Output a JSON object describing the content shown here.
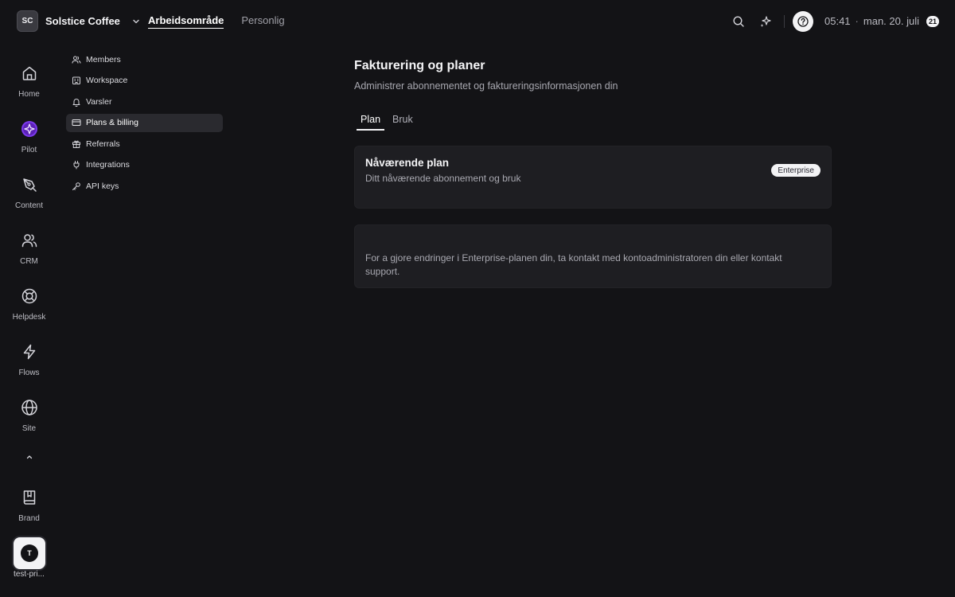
{
  "workspace": {
    "initials": "SC",
    "name": "Solstice Coffee"
  },
  "top_tabs": [
    {
      "label": "Arbeidsområde",
      "active": true
    },
    {
      "label": "Personlig",
      "active": false
    }
  ],
  "top_right": {
    "icons": [
      "search-icon",
      "sparkles-icon",
      "help-icon"
    ],
    "time": "05:41",
    "separator": "·",
    "date": "man. 20. juli",
    "day_badge": "21"
  },
  "rail": {
    "items": [
      {
        "label": "Home",
        "icon": "home-icon"
      },
      {
        "label": "Pilot",
        "icon": "pilot-icon"
      },
      {
        "label": "Content",
        "icon": "pen-tool-icon"
      },
      {
        "label": "CRM",
        "icon": "users-icon"
      },
      {
        "label": "Helpdesk",
        "icon": "lifebuoy-icon"
      },
      {
        "label": "Flows",
        "icon": "zap-icon"
      },
      {
        "label": "Site",
        "icon": "globe-icon"
      }
    ],
    "brand": {
      "label": "Brand",
      "icon": "book-icon"
    },
    "user": {
      "initial": "T",
      "label": "test-pri..."
    }
  },
  "settings_nav": {
    "items": [
      {
        "label": "Members",
        "icon": "users-icon",
        "active": false
      },
      {
        "label": "Workspace",
        "icon": "building-icon",
        "active": false
      },
      {
        "label": "Varsler",
        "icon": "bell-icon",
        "active": false
      },
      {
        "label": "Plans & billing",
        "icon": "credit-card-icon",
        "active": true
      },
      {
        "label": "Referrals",
        "icon": "gift-icon",
        "active": false
      },
      {
        "label": "Integrations",
        "icon": "plug-icon",
        "active": false
      },
      {
        "label": "API keys",
        "icon": "key-icon",
        "active": false
      }
    ]
  },
  "main": {
    "title": "Fakturering og planer",
    "subtitle": "Administrer abonnementet og faktureringsinformasjonen din",
    "tabs": [
      {
        "label": "Plan",
        "active": true
      },
      {
        "label": "Bruk",
        "active": false
      }
    ],
    "plan_card": {
      "title": "Nåværende plan",
      "subtitle": "Ditt nåværende abonnement og bruk",
      "badge": "Enterprise"
    },
    "info_card": {
      "text": "For a gjore endringer i Enterprise-planen din, ta kontakt med kontoadministratoren din eller kontakt support."
    }
  },
  "colors": {
    "background": "#131316",
    "card": "#1e1e22",
    "active_nav": "#2a2a2f",
    "pilot_accent": "#7c3aed"
  }
}
